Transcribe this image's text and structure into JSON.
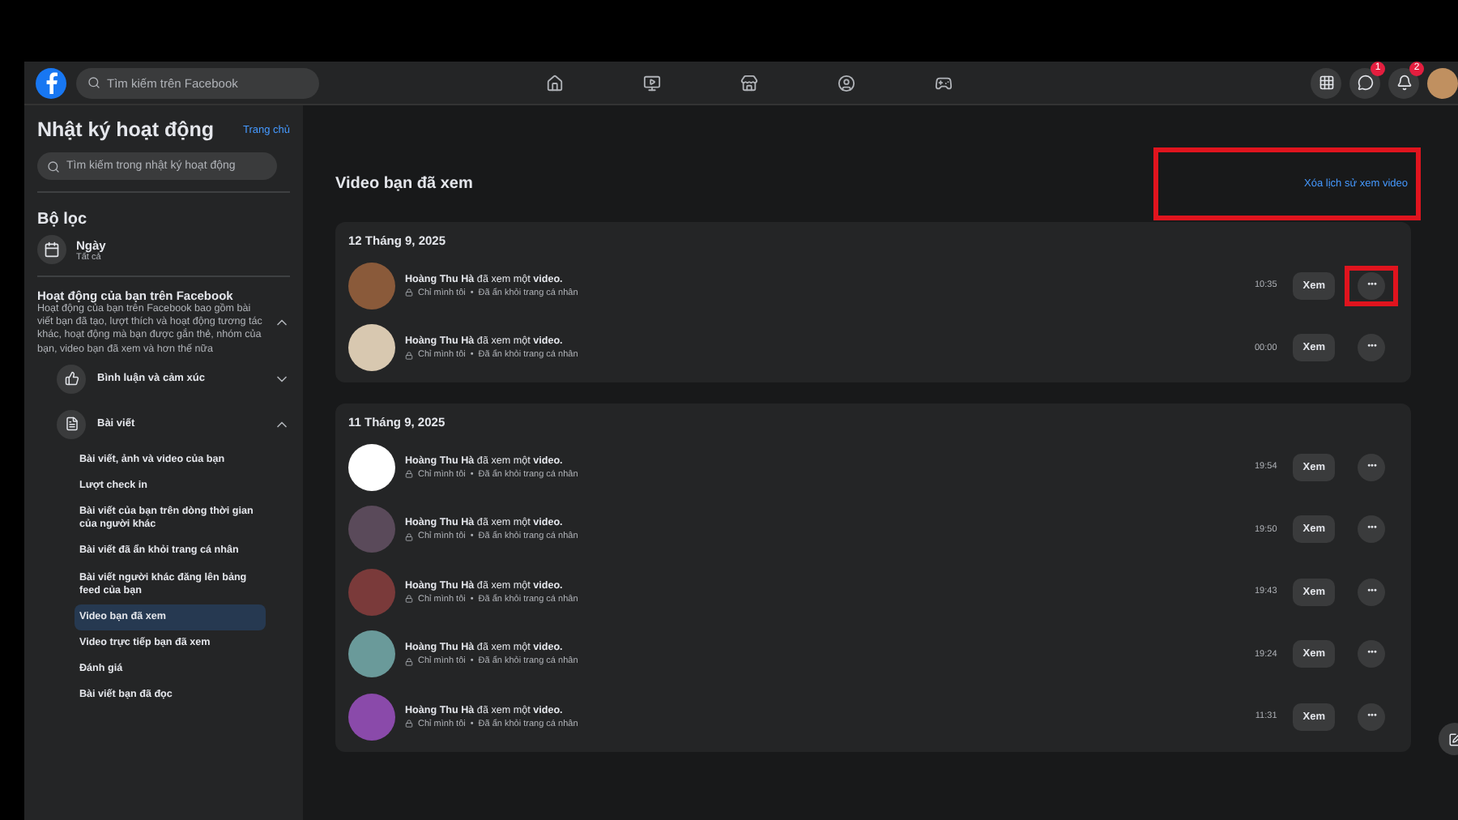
{
  "topbar": {
    "search_placeholder": "Tìm kiếm trên Facebook",
    "nav": [
      {
        "selected": false
      },
      {
        "selected": false
      },
      {
        "selected": false
      },
      {
        "selected": false
      },
      {
        "selected": false
      }
    ],
    "notifications": [
      {
        "badge": "1"
      },
      {
        "badge": "2"
      }
    ]
  },
  "sidebar": {
    "title": "Nhật ký hoạt động",
    "home_link": "Trang chủ",
    "search_placeholder": "Tìm kiếm trong nhật ký hoạt động",
    "filter_heading": "Bộ lọc",
    "date_filter": {
      "label": "Ngày",
      "value": "Tất cả"
    },
    "section": {
      "title": "Hoạt động của bạn trên Facebook",
      "description": "Hoạt động của bạn trên Facebook bao gồm bài viết bạn đã tạo, lượt thích và hoạt động tương tác khác, hoạt động mà bạn được gắn thẻ, nhóm của bạn, video bạn đã xem và hơn thế nữa",
      "expanded": true
    },
    "categories": [
      {
        "label": "Bình luận và cảm xúc",
        "expanded": false
      },
      {
        "label": "Bài viết",
        "expanded": true,
        "children": [
          {
            "label": "Bài viết, ảnh và video của bạn",
            "selected": false
          },
          {
            "label": "Lượt check in",
            "selected": false
          },
          {
            "label": "Bài viết của bạn trên dòng thời gian của người khác",
            "selected": false
          },
          {
            "label": "Bài viết đã ẩn khỏi trang cá nhân",
            "selected": false
          },
          {
            "label": "Bài viết người khác đăng lên bảng feed của bạn",
            "selected": false
          },
          {
            "label": "Video bạn đã xem",
            "selected": true
          },
          {
            "label": "Video trực tiếp bạn đã xem",
            "selected": false
          },
          {
            "label": "Đánh giá",
            "selected": false
          },
          {
            "label": "Bài viết bạn đã đọc",
            "selected": false
          }
        ]
      }
    ]
  },
  "main": {
    "title": "Video bạn đã xem",
    "clear_link": {
      "label": "Xóa lịch sử xem video",
      "highlighted": true
    },
    "groups": [
      {
        "date": "12 Tháng 9, 2025",
        "rows": [
          {
            "text": "**Hoàng Thu Hà** đã xem một **video.**",
            "privacy": "Chỉ mình tôi",
            "separator": "•",
            "status": "Đã ẩn khỏi trang cá nhân",
            "time": "10:35",
            "button": "Xem",
            "more": "•••",
            "highlighted": true,
            "color": "#8a5a3a"
          },
          {
            "text": "**Hoàng Thu Hà** đã xem một **video.**",
            "privacy": "Chỉ mình tôi",
            "separator": "•",
            "status": "Đã ẩn khỏi trang cá nhân",
            "time": "00:00",
            "button": "Xem",
            "more": "•••",
            "highlighted": false,
            "color": "#d8c8b0"
          }
        ]
      },
      {
        "date": "11 Tháng 9, 2025",
        "rows": [
          {
            "text": "**Hoàng Thu Hà** đã xem một **video.**",
            "privacy": "Chỉ mình tôi",
            "separator": "•",
            "status": "Đã ẩn khỏi trang cá nhân",
            "time": "19:54",
            "button": "Xem",
            "more": "•••",
            "highlighted": false,
            "color": "#ffffff"
          },
          {
            "text": "**Hoàng Thu Hà** đã xem một **video.**",
            "privacy": "Chỉ mình tôi",
            "separator": "•",
            "status": "Đã ẩn khỏi trang cá nhân",
            "time": "19:50",
            "button": "Xem",
            "more": "•••",
            "highlighted": false,
            "color": "#5a4a5a"
          },
          {
            "text": "**Hoàng Thu Hà** đã xem một **video.**",
            "privacy": "Chỉ mình tôi",
            "separator": "•",
            "status": "Đã ẩn khỏi trang cá nhân",
            "time": "19:43",
            "button": "Xem",
            "more": "•••",
            "highlighted": false,
            "color": "#7a3a3a"
          },
          {
            "text": "**Hoàng Thu Hà** đã xem một **video.**",
            "privacy": "Chỉ mình tôi",
            "separator": "•",
            "status": "Đã ẩn khỏi trang cá nhân",
            "time": "19:24",
            "button": "Xem",
            "more": "•••",
            "highlighted": false,
            "color": "#6a9a9a"
          },
          {
            "text": "**Hoàng Thu Hà** đã xem một **video.**",
            "privacy": "Chỉ mình tôi",
            "separator": "•",
            "status": "Đã ẩn khỏi trang cá nhân",
            "time": "11:31",
            "button": "Xem",
            "more": "•••",
            "highlighted": false,
            "color": "#8a4aaa"
          }
        ]
      }
    ]
  }
}
